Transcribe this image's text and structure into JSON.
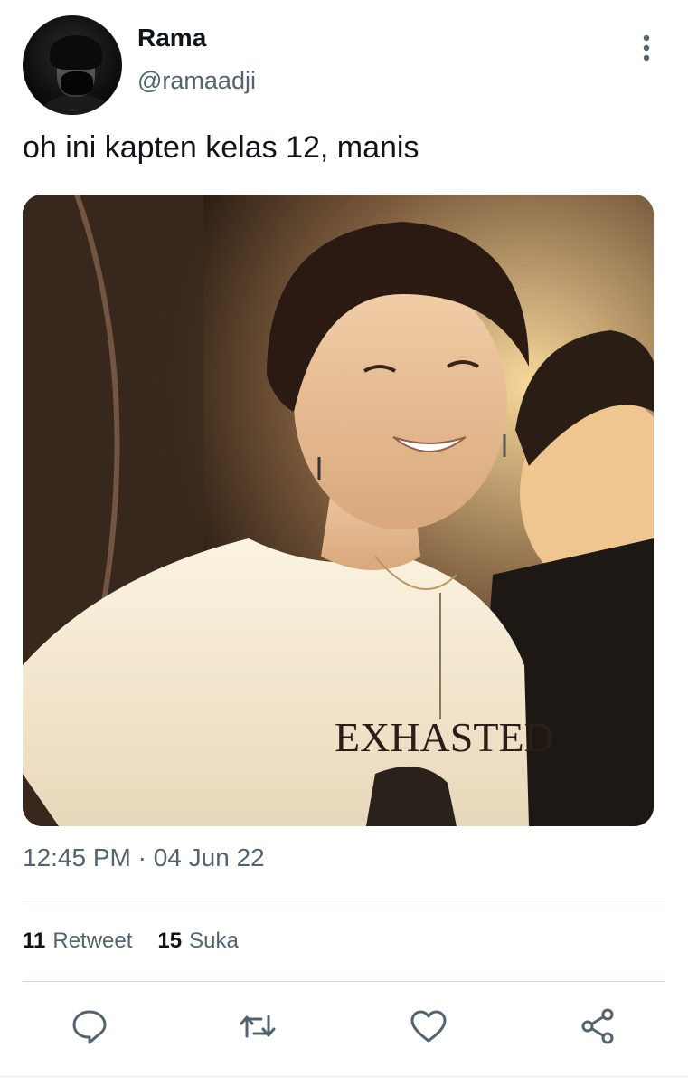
{
  "tweet": {
    "display_name": "Rama",
    "handle": "@ramaadji",
    "text": "oh ini kapten kelas 12, manis",
    "timestamp": "12:45 PM · 04 Jun 22",
    "media": {
      "shirt_text": "EXHASTED"
    }
  },
  "stats": {
    "retweets_count": "11",
    "retweets_label": "Retweet",
    "likes_count": "15",
    "likes_label": "Suka"
  },
  "actions": {
    "reply_icon": "reply-icon",
    "retweet_icon": "retweet-icon",
    "like_icon": "heart-icon",
    "share_icon": "share-icon"
  },
  "colors": {
    "text_primary": "#0f1419",
    "text_secondary": "#536471",
    "icon": "#536471",
    "divider": "#cfd9de"
  }
}
